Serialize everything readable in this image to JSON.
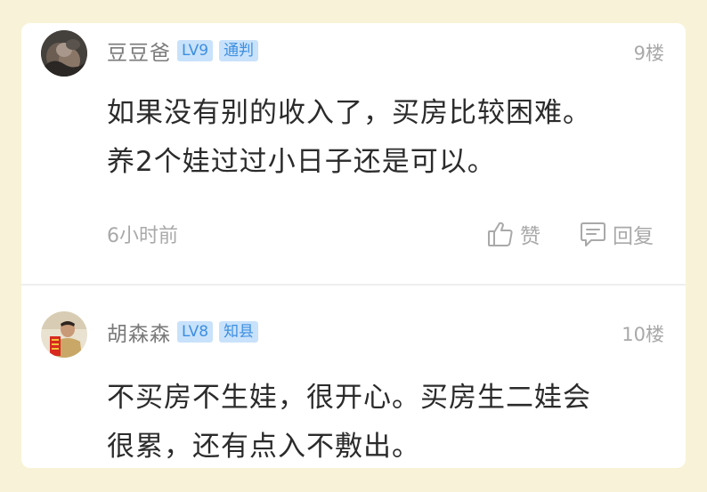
{
  "comments": [
    {
      "username": "豆豆爸",
      "level": "LV9",
      "rank": "通判",
      "floor": "9楼",
      "content_lines": [
        "如果没有别的收入了，买房比较困难。",
        "养2个娃过过小日子还是可以。"
      ],
      "time": "6小时前",
      "like_label": "赞",
      "reply_label": "回复"
    },
    {
      "username": "胡森森",
      "level": "LV8",
      "rank": "知县",
      "floor": "10楼",
      "content_lines": [
        "不买房不生娃，很开心。买房生二娃会",
        "很累，还有点入不敷出。"
      ]
    }
  ],
  "icons": {
    "like": "thumbs-up-icon",
    "reply": "comment-bubble-icon"
  },
  "colors": {
    "background": "#f8f3d8",
    "badge_bg": "#c9e2fb",
    "badge_text": "#3d8fe0",
    "muted_text": "#a9a9a9",
    "body_text": "#2b2b2b"
  }
}
